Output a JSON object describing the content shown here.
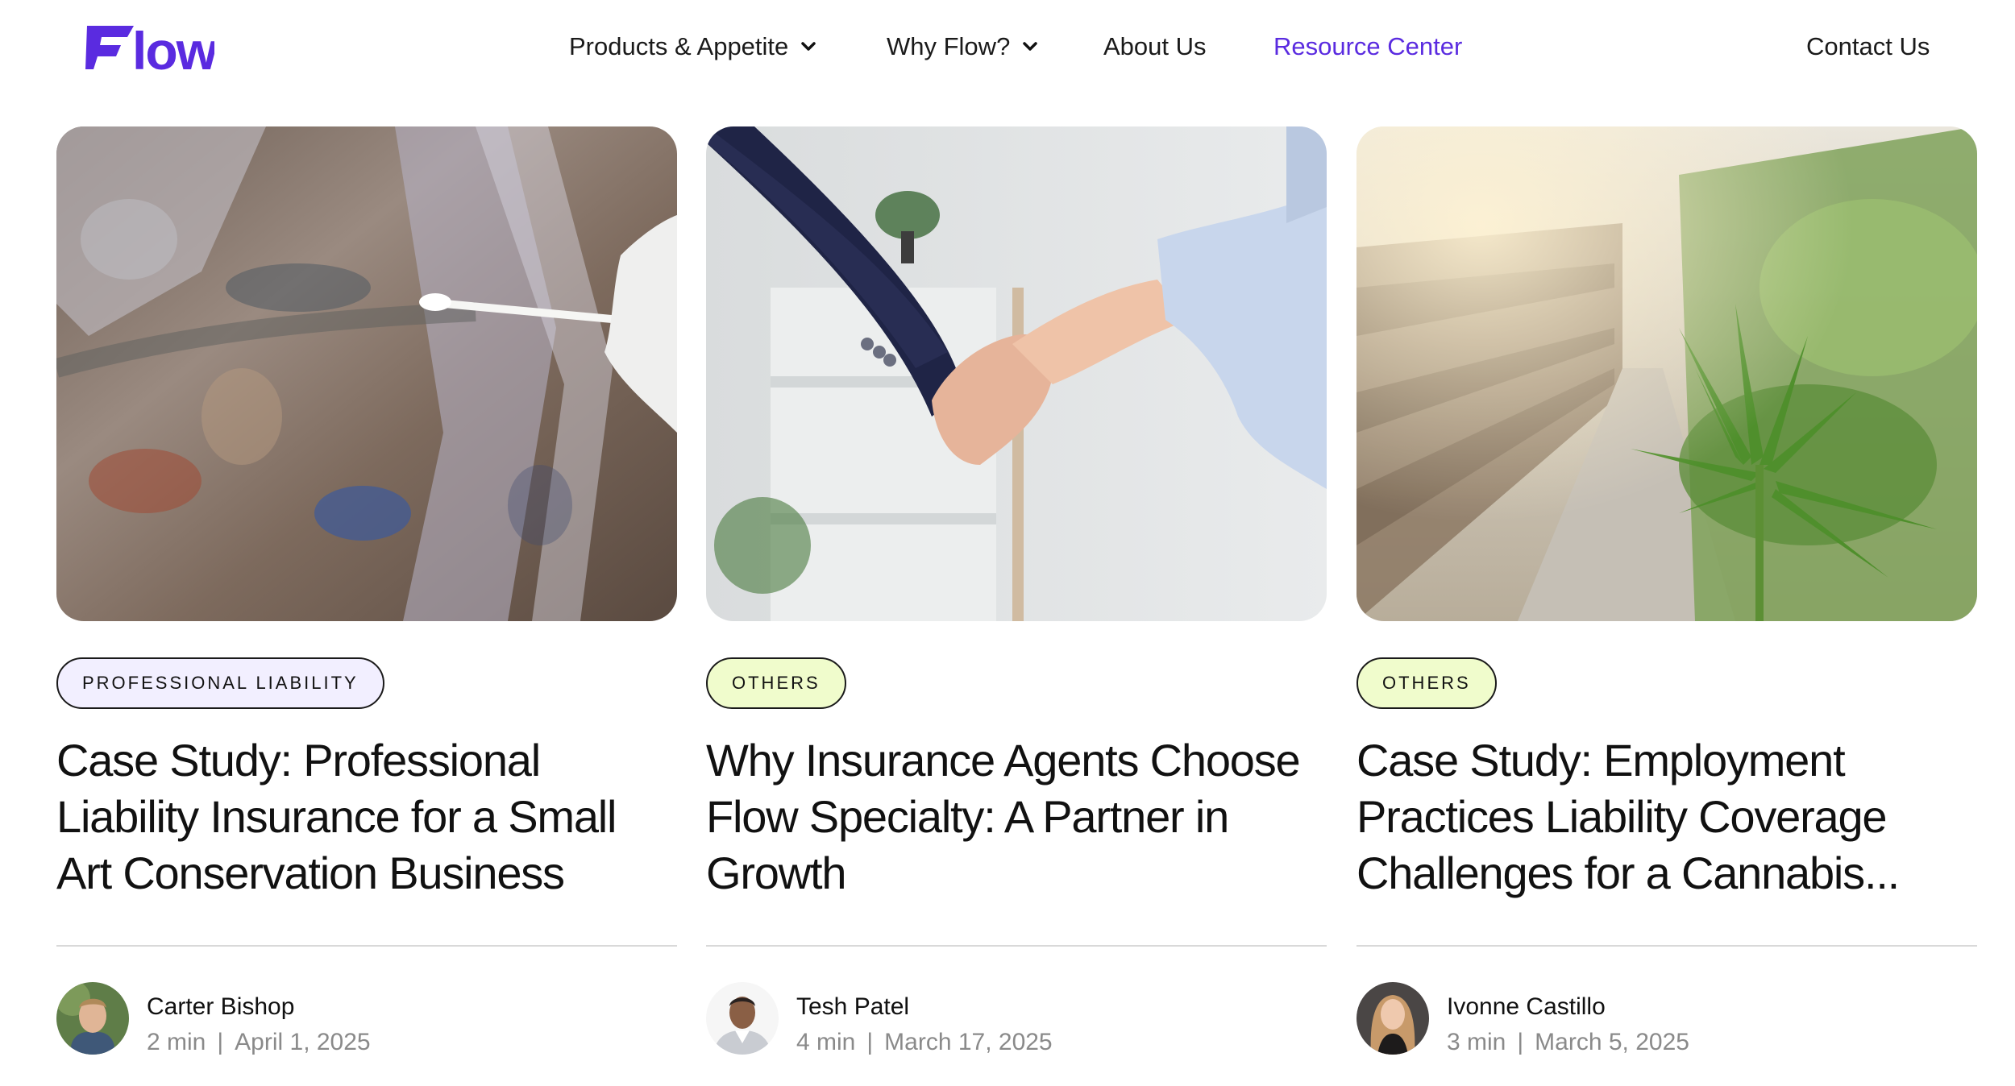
{
  "brand": {
    "logo_text": "Flow",
    "accent": "#5a2be0"
  },
  "nav": {
    "items": [
      {
        "label": "Products & Appetite",
        "has_dropdown": true
      },
      {
        "label": "Why Flow?",
        "has_dropdown": true
      },
      {
        "label": "About Us",
        "has_dropdown": false
      },
      {
        "label": "Resource Center",
        "has_dropdown": false,
        "active": true
      }
    ],
    "contact_label": "Contact Us"
  },
  "cards": [
    {
      "image": "art-conservation-photo",
      "tag": "PROFESSIONAL LIABILITY",
      "tag_color": "#f2efff",
      "title": "Case Study: Professional Liability Insurance for a Small Art Conservation Business",
      "author": "Carter Bishop",
      "read_time": "2 min",
      "date": "April 1, 2025"
    },
    {
      "image": "handshake-photo",
      "tag": "OTHERS",
      "tag_color": "#f0fccc",
      "title": "Why Insurance Agents Choose Flow Specialty: A Partner in Growth",
      "author": "Tesh Patel",
      "read_time": "4 min",
      "date": "March 17, 2025"
    },
    {
      "image": "cannabis-greenhouse-photo",
      "tag": "OTHERS",
      "tag_color": "#f0fccc",
      "title": "Case Study: Employment Practices Liability Coverage Challenges for a Cannabis...",
      "author": "Ivonne Castillo",
      "read_time": "3 min",
      "date": "March 5, 2025"
    }
  ]
}
